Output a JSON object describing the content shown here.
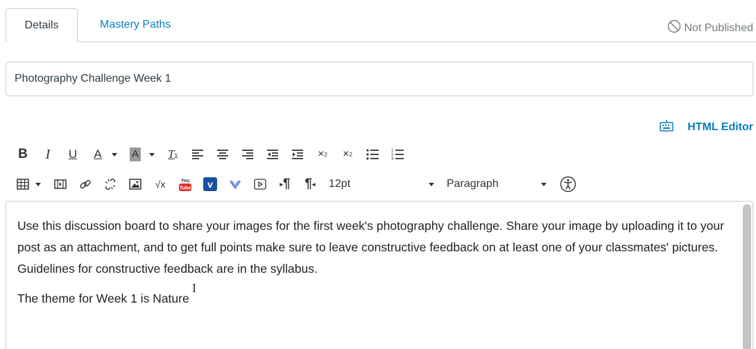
{
  "tabs": [
    {
      "label": "Details",
      "active": true
    },
    {
      "label": "Mastery Paths",
      "active": false
    }
  ],
  "publish_status": "Not Published",
  "title_input": {
    "value": "Photography Challenge Week 1"
  },
  "html_editor_label": "HTML Editor",
  "toolbar": {
    "font_size": "12pt",
    "block_format": "Paragraph",
    "icons_row1": [
      "bold-icon",
      "italic-icon",
      "underline-icon",
      "text-color-icon",
      "background-color-icon",
      "clear-formatting-icon",
      "align-left-icon",
      "align-center-icon",
      "align-right-icon",
      "outdent-icon",
      "indent-icon",
      "superscript-icon",
      "subscript-icon",
      "bullet-list-icon",
      "numbered-list-icon"
    ],
    "icons_row2": [
      "table-icon",
      "media-icon",
      "link-icon",
      "unlink-icon",
      "image-icon",
      "equation-icon",
      "youtube-icon",
      "vimeo-icon",
      "vimeo-alt-icon",
      "embed-icon",
      "ltr-icon",
      "rtl-icon",
      "accessibility-icon"
    ]
  },
  "editor": {
    "paragraphs": [
      "Use this discussion board to share your images for the first week's photography challenge. Share your image by uploading it to your post as an attachment, and to get full points make sure to leave constructive feedback on at least one of your classmates' pictures. Guidelines for constructive feedback are in the syllabus.",
      "The theme for Week 1 is Nature"
    ]
  },
  "colors": {
    "link": "#0b7ec2",
    "border": "#c7cdd1",
    "muted": "#737b80"
  }
}
